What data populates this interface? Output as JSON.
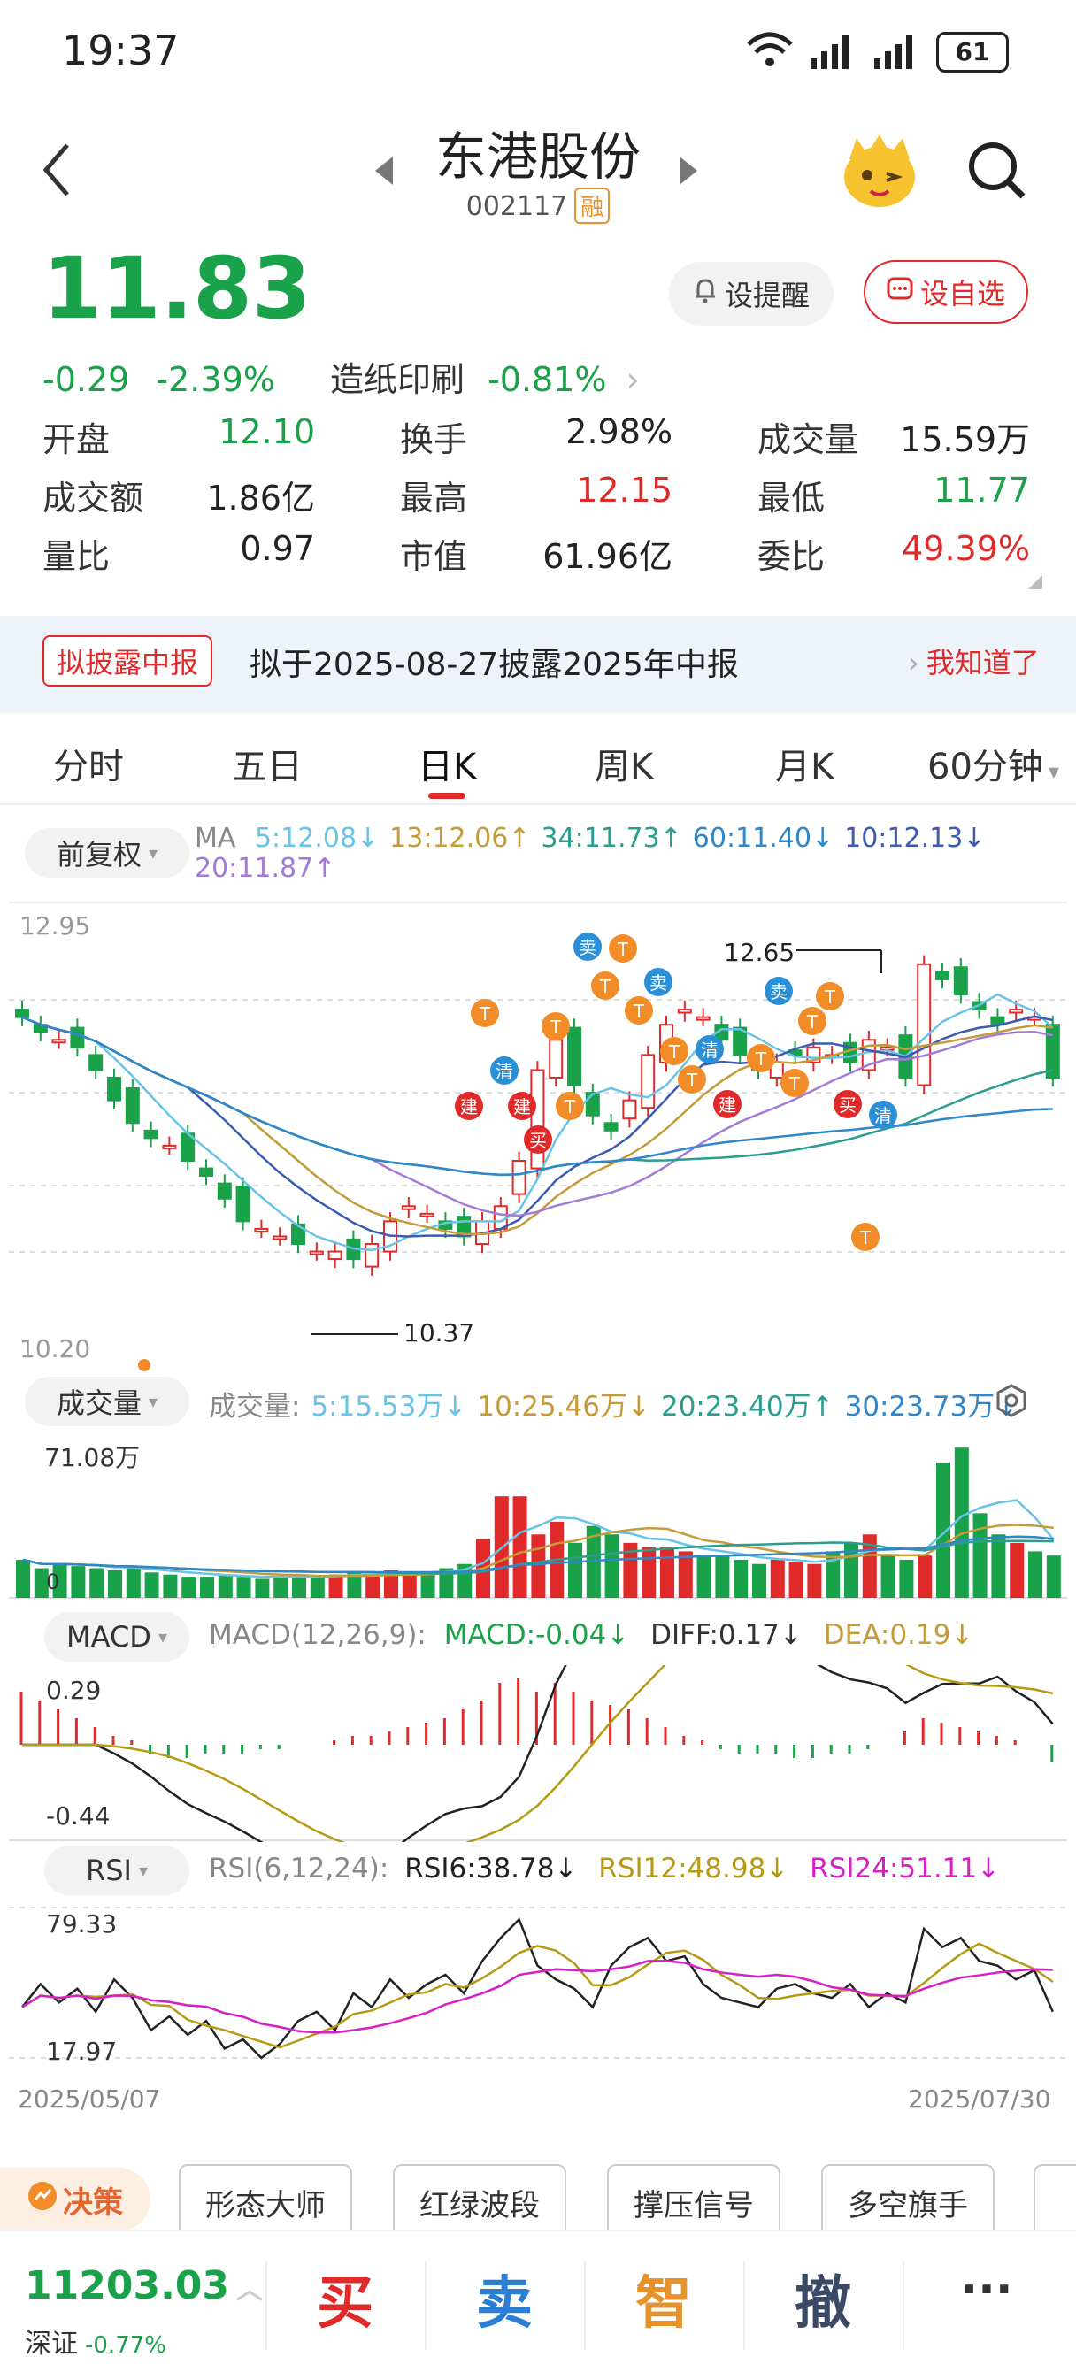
{
  "status_bar": {
    "time": "19:37",
    "battery": "61"
  },
  "header": {
    "name": "东港股份",
    "code": "002117",
    "badge": "融"
  },
  "quote": {
    "price": "11.83",
    "change": "-0.29",
    "change_pct": "-2.39%",
    "sector": "造纸印刷",
    "sector_pct": "-0.81%",
    "remind_label": "设提醒",
    "watch_label": "设自选"
  },
  "stats": [
    [
      {
        "label": "开盘",
        "value": "12.10",
        "color": "green"
      },
      {
        "label": "换手",
        "value": "2.98%",
        "color": "black"
      },
      {
        "label": "成交量",
        "value": "15.59万",
        "color": "black"
      }
    ],
    [
      {
        "label": "成交额",
        "value": "1.86亿",
        "color": "black"
      },
      {
        "label": "最高",
        "value": "12.15",
        "color": "red"
      },
      {
        "label": "最低",
        "value": "11.77",
        "color": "green"
      }
    ],
    [
      {
        "label": "量比",
        "value": "0.97",
        "color": "black"
      },
      {
        "label": "市值",
        "value": "61.96亿",
        "color": "black"
      },
      {
        "label": "委比",
        "value": "49.39%",
        "color": "red"
      }
    ]
  ],
  "notice": {
    "tag": "拟披露中报",
    "text": "拟于2025-08-27披露2025年中报",
    "action": "我知道了"
  },
  "tabs": [
    "分时",
    "五日",
    "日K",
    "周K",
    "月K",
    "60分钟"
  ],
  "kline": {
    "adjust_label": "前复权",
    "ma_label": "MA",
    "ma": [
      {
        "text": "5:12.08↓",
        "color": "#69c3e6"
      },
      {
        "text": "13:12.06↑",
        "color": "#c59b3a"
      },
      {
        "text": "34:11.73↑",
        "color": "#2a9d8f"
      },
      {
        "text": "60:11.40↓",
        "color": "#2f86c8"
      },
      {
        "text": "10:12.13↓",
        "color": "#3b5bb0"
      }
    ],
    "ma_line2": {
      "text": "20:11.87↑",
      "color": "#a27ad8"
    },
    "y_top": "12.95",
    "y_bottom": "10.20",
    "high_label": "12.65",
    "low_label": "10.37"
  },
  "volume": {
    "chip": "成交量",
    "label": "成交量:",
    "items": [
      {
        "text": "5:15.53万↓",
        "color": "#69c3e6"
      },
      {
        "text": "10:25.46万↓",
        "color": "#c59b3a"
      },
      {
        "text": "20:23.40万↑",
        "color": "#2a9d8f"
      },
      {
        "text": "30:23.73万↓",
        "color": "#2f86c8"
      }
    ],
    "top": "71.08万",
    "bottom": "0"
  },
  "macd": {
    "chip": "MACD",
    "params": "MACD(12,26,9):",
    "macd": "MACD:-0.04↓",
    "diff": "DIFF:0.17↓",
    "dea": "DEA:0.19↓",
    "top": "0.29",
    "bottom": "-0.44"
  },
  "rsi": {
    "chip": "RSI",
    "params": "RSI(6,12,24):",
    "rsi6": "RSI6:38.78↓",
    "rsi12": "RSI12:48.98↓",
    "rsi24": "RSI24:51.11↓",
    "top": "79.33",
    "bottom": "17.97"
  },
  "dates": {
    "start": "2025/05/07",
    "end": "2025/07/30"
  },
  "tools": {
    "decision": "决策",
    "items": [
      "形态大师",
      "红绿波段",
      "撑压信号",
      "多空旗手"
    ]
  },
  "bottom": {
    "index_value": "11203.03",
    "index_name": "深证",
    "index_pct": "-0.77%",
    "buy": "买",
    "sell": "卖",
    "smart": "智",
    "cancel": "撤",
    "more": "···"
  },
  "colors": {
    "up": "#e02a2a",
    "down": "#1aa24a",
    "accent": "#e02a2a"
  }
}
